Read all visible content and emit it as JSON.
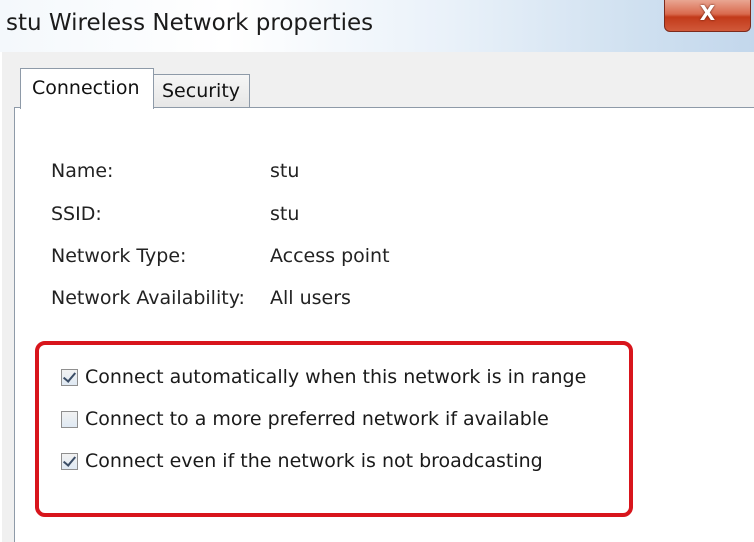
{
  "window": {
    "title": "stu Wireless Network properties",
    "close_glyph": "X"
  },
  "tabs": [
    {
      "label": "Connection",
      "selected": true
    },
    {
      "label": "Security",
      "selected": false
    }
  ],
  "properties": [
    {
      "label": "Name:",
      "value": "stu"
    },
    {
      "label": "SSID:",
      "value": "stu"
    },
    {
      "label": "Network Type:",
      "value": "Access point"
    },
    {
      "label": "Network Availability:",
      "value": "All users"
    }
  ],
  "options": [
    {
      "label": "Connect automatically when this network is in range",
      "checked": true
    },
    {
      "label": "Connect to a more preferred network if available",
      "checked": false
    },
    {
      "label": "Connect even if the network is not broadcasting",
      "checked": true
    }
  ],
  "colors": {
    "highlight_border": "#d8151c",
    "close_button": "#c23a1a"
  },
  "icons": {
    "close": "close-icon",
    "checkbox_checked": "checkmark-icon"
  }
}
